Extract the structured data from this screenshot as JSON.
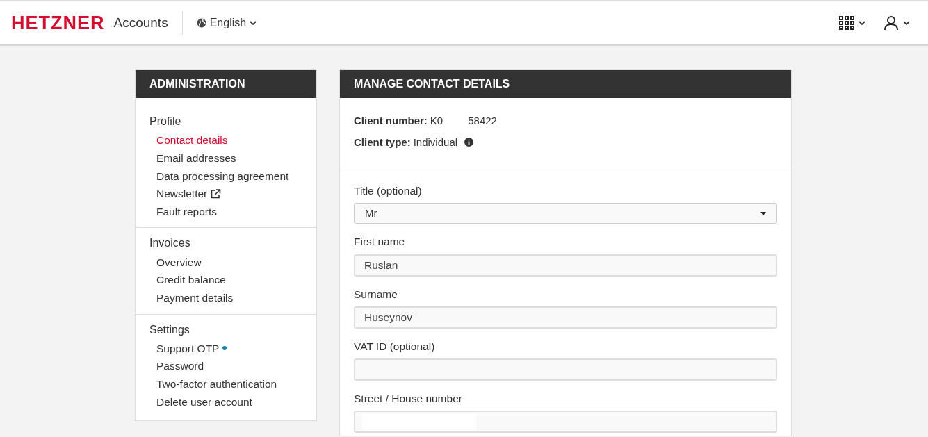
{
  "header": {
    "logo": "HETZNER",
    "product": "Accounts",
    "language": "English"
  },
  "sidebar": {
    "title": "ADMINISTRATION",
    "sections": [
      {
        "heading": "Profile",
        "items": [
          {
            "label": "Contact details",
            "selected": true,
            "kind": "plain"
          },
          {
            "label": "Email addresses",
            "selected": false,
            "kind": "plain"
          },
          {
            "label": "Data processing agreement",
            "selected": false,
            "kind": "plain"
          },
          {
            "label": "Newsletter",
            "selected": false,
            "kind": "external"
          },
          {
            "label": "Fault reports",
            "selected": false,
            "kind": "plain"
          }
        ]
      },
      {
        "heading": "Invoices",
        "items": [
          {
            "label": "Overview",
            "selected": false,
            "kind": "plain"
          },
          {
            "label": "Credit balance",
            "selected": false,
            "kind": "plain"
          },
          {
            "label": "Payment details",
            "selected": false,
            "kind": "plain"
          }
        ]
      },
      {
        "heading": "Settings",
        "items": [
          {
            "label": "Support OTP",
            "selected": false,
            "kind": "dot",
            "color": "#1a7fae"
          },
          {
            "label": "Password",
            "selected": false,
            "kind": "plain"
          },
          {
            "label": "Two-factor authentication",
            "selected": false,
            "kind": "plain"
          },
          {
            "label": "Delete user account",
            "selected": false,
            "kind": "plain"
          }
        ]
      }
    ]
  },
  "main": {
    "title": "MANAGE CONTACT DETAILS",
    "client_number": {
      "label": "Client number:",
      "value_start": "K0",
      "value_end": "58422"
    },
    "client_type": {
      "label": "Client type:",
      "value": "Individual"
    },
    "fields": [
      {
        "label": "Title (optional)",
        "kind": "select",
        "value": "Mr"
      },
      {
        "label": "First name",
        "kind": "text",
        "value": "Ruslan"
      },
      {
        "label": "Surname",
        "kind": "text",
        "value": "Huseynov"
      },
      {
        "label": "VAT ID (optional)",
        "kind": "text"
      },
      {
        "label": "Street / House number",
        "kind": "redacted"
      }
    ]
  }
}
